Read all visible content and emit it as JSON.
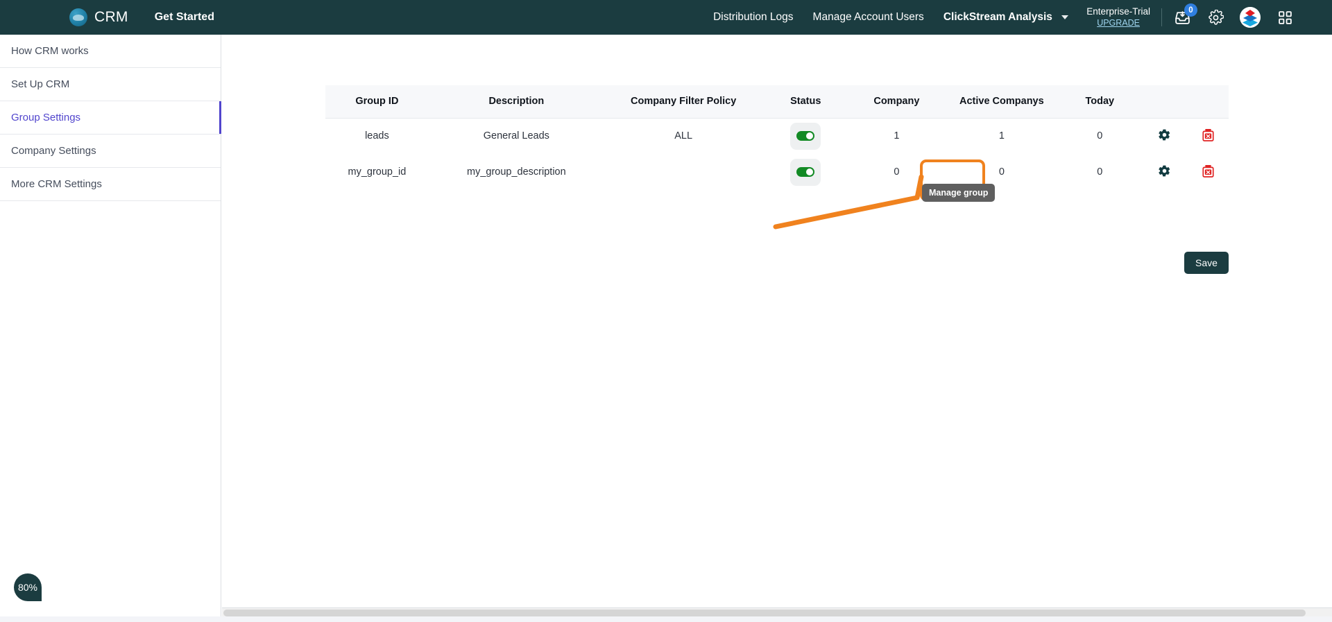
{
  "header": {
    "brand": "CRM",
    "get_started": "Get Started",
    "nav_links": [
      {
        "label": "Distribution Logs",
        "bold": false,
        "caret": false
      },
      {
        "label": "Manage Account Users",
        "bold": false,
        "caret": false
      },
      {
        "label": "ClickStream Analysis",
        "bold": true,
        "caret": true
      }
    ],
    "plan_name": "Enterprise-Trial",
    "plan_upgrade": "UPGRADE",
    "icons": {
      "inbox": "inbox-download-icon",
      "inbox_badge": "0",
      "gear": "gear-icon",
      "product_logo": "product-logo-icon",
      "apps_grid": "apps-grid-icon"
    },
    "brand_logo": "crm-cloud-logo-icon"
  },
  "sidebar": {
    "items": [
      {
        "label": "How CRM works",
        "active": false
      },
      {
        "label": "Set Up CRM",
        "active": false
      },
      {
        "label": "Group Settings",
        "active": true
      },
      {
        "label": "Company Settings",
        "active": false
      },
      {
        "label": "More CRM Settings",
        "active": false
      }
    ]
  },
  "table": {
    "headers": [
      "Group ID",
      "Description",
      "Company Filter Policy",
      "Status",
      "Company",
      "Active Companys",
      "Today",
      "",
      ""
    ],
    "rows": [
      {
        "group_id": "leads",
        "description": "General Leads",
        "policy": "ALL",
        "status_on": true,
        "company": "1",
        "active_companys": "1",
        "today": "0",
        "gear": "gear-icon",
        "delete": "delete-icon"
      },
      {
        "group_id": "my_group_id",
        "description": "my_group_description",
        "policy": "",
        "status_on": true,
        "company": "0",
        "active_companys": "0",
        "today": "0",
        "gear": "gear-icon",
        "delete": "delete-icon"
      }
    ]
  },
  "tooltip": {
    "text": "Manage group"
  },
  "buttons": {
    "save": "Save"
  },
  "zoom_badge": {
    "value": "80%"
  },
  "colors": {
    "header_bg": "#1b3c40",
    "accent_purple": "#5145cd",
    "highlight_orange": "#f0821e",
    "toggle_green": "#128a24",
    "delete_red": "#e02424",
    "badge_blue": "#2f7fe0"
  }
}
